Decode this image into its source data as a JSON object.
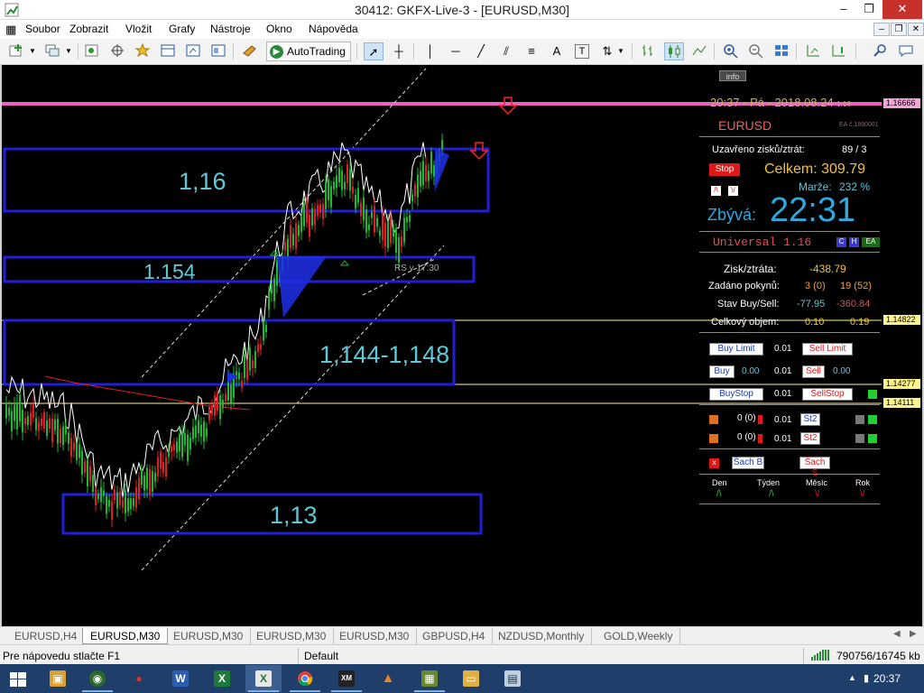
{
  "window": {
    "title": "30412: GKFX-Live-3 - [EURUSD,M30]",
    "minimize": "‒",
    "restore": "❐",
    "close": "✕"
  },
  "menu": {
    "items": [
      "Soubor",
      "Zobrazit",
      "Vložit",
      "Grafy",
      "Nástroje",
      "Okno",
      "Nápověda"
    ],
    "mdi_minimize": "‒",
    "mdi_restore": "❐",
    "mdi_close": "✕"
  },
  "toolbar": {
    "autotrading_label": "AutoTrading",
    "text_tool": "A",
    "label_tool": "T"
  },
  "chart": {
    "symbol": "EURUSD",
    "timeframe": "M30",
    "info_label": "info",
    "clock_text": "20:37 - Pá - 2018.08.24",
    "clock_suffix": "1:16",
    "box_labels": [
      "1,16",
      "1.154",
      "1,144-1,148",
      "1,13"
    ],
    "price_tags": [
      {
        "value": "1.16666",
        "color": "#f4a4d8"
      },
      {
        "value": "1.14822",
        "color": "#fff48a"
      },
      {
        "value": "1.14277",
        "color": "#fff48a"
      },
      {
        "value": "1.14111",
        "color": "#fff48a"
      }
    ],
    "rs_label": "RS v 17:30",
    "colors": {
      "box": "#1f1fd8",
      "bull": "#1fb82f",
      "bear": "#e02020",
      "shadow_line": "#ffffff",
      "level_pink": "#f060c0",
      "level_yellow": "#fff0a0"
    }
  },
  "panel": {
    "symbol": "EURUSD",
    "ea_id": "EA č.1890001",
    "closed_label": "Uzavřeno zisků/ztrát:",
    "closed_value": "89 / 3",
    "stop_label": "Stop",
    "total_label": "Celkem: 309.79",
    "margin_label": "Marže:",
    "margin_value": "232 %",
    "remaining_label": "Zbývá:",
    "remaining_value": "22:31",
    "universal_label": "Universal 1.16",
    "badges": [
      "C",
      "H",
      "EA"
    ],
    "pl_label": "Zisk/ztráta:",
    "pl_value": "-438.79",
    "orders_label": "Zadáno pokynů:",
    "orders_buy": "3 (0)",
    "orders_sell": "19 (52)",
    "state_label": "Stav Buy/Sell:",
    "state_buy": "-77.95",
    "state_sell": "-360.84",
    "volume_label": "Celkový objem:",
    "volume_buy": "0.10",
    "volume_sell": "0.19",
    "buy_limit": "Buy Limit",
    "sell_limit": "Sell Limit",
    "lot_1": "0.01",
    "buy": "Buy",
    "sell": "Sell",
    "buy_price": "0.00",
    "sell_price": "0.00",
    "lot_2": "0.01",
    "buy_stop": "BuyStop",
    "sell_stop": "SellStop",
    "lot_3": "0.01",
    "row1_count": "0 (0)",
    "row1_lot": "0.01",
    "row1_btn": "St2",
    "row2_count": "0 (0)",
    "row2_lot": "0.01",
    "row2_btn": "St2",
    "x_label": "x",
    "sach_b": "Šach B",
    "sach_s": "Šach S",
    "period_labels": [
      "Den",
      "Týden",
      "Měsíc",
      "Rok"
    ],
    "period_marks": [
      "/\\",
      "/\\",
      "\\/",
      "\\/"
    ]
  },
  "tabs": {
    "items": [
      "EURUSD,H4",
      "EURUSD,M30",
      "EURUSD,M30",
      "EURUSD,M30",
      "EURUSD,M30",
      "GBPUSD,H4",
      "NZDUSD,Monthly",
      "GOLD,Weekly"
    ],
    "active_index": 1
  },
  "status": {
    "help": "Pre nápovedu stlačte F1",
    "profile": "Default",
    "traffic": "790756/16745 kb"
  },
  "taskbar": {
    "time": "20:37"
  }
}
